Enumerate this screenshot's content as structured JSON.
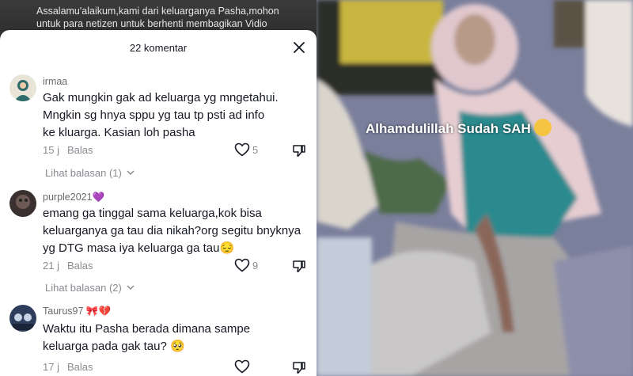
{
  "caption": "Assalamu'alaikum,kami dari keluarganya Pasha,mohon untuk para netizen untuk berhenti membagikan Vidio",
  "sheet": {
    "title": "22 komentar"
  },
  "comments": [
    {
      "username": "irmaa",
      "text": "Gak mungkin gak ad keluarga yg mngetahui. Mngkin sg hnya sppu yg tau tp psti ad info ke kluarga. Kasian loh pasha",
      "time": "15 j",
      "reply_label": "Balas",
      "likes": "5",
      "view_replies": "Lihat balasan (1)"
    },
    {
      "username": "purple2021💜",
      "text": "emang ga tinggal sama keluarga,kok bisa keluarganya ga tau dia nikah?org segitu bnyknya yg DTG masa iya keluarga ga tau😔",
      "time": "21 j",
      "reply_label": "Balas",
      "likes": "9",
      "view_replies": "Lihat balasan (2)"
    },
    {
      "username": "Taurus97 🎀💔",
      "text": "Waktu itu Pasha berada dimana sampe keluarga pada gak tau? 🥺",
      "time": "17 j",
      "reply_label": "Balas",
      "likes": ""
    }
  ],
  "video": {
    "overlay_text": "Alhamdulillah Sudah SAH"
  },
  "colors": {
    "sheet_bg": "#ffffff",
    "text": "#161823",
    "muted": "#8a8b91"
  },
  "icons": [
    "close-icon",
    "heart-icon",
    "dislike-icon",
    "chevron-down-icon"
  ]
}
